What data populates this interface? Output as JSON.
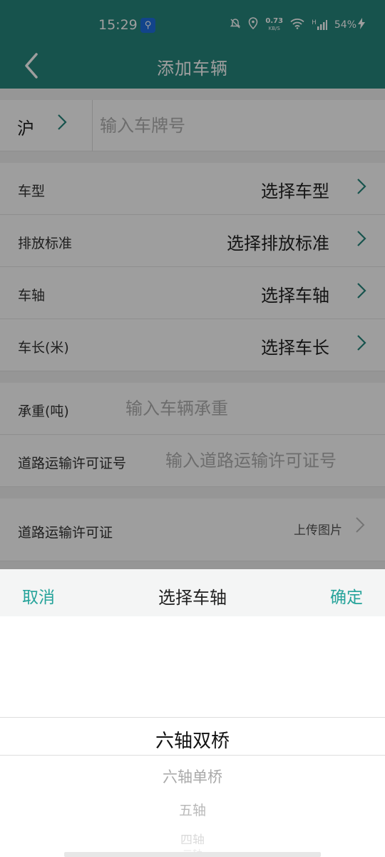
{
  "status_bar": {
    "time": "15:29",
    "speed_value": "0.73",
    "speed_unit": "KB/S",
    "network": "H",
    "battery": "54%"
  },
  "header": {
    "back_icon": "chevron-left-icon",
    "title": "添加车辆"
  },
  "plate": {
    "province": "沪",
    "placeholder": "输入车牌号"
  },
  "form": {
    "vehicle_type": {
      "label": "车型",
      "value": "选择车型"
    },
    "emission": {
      "label": "排放标准",
      "value": "选择排放标准"
    },
    "axle": {
      "label": "车轴",
      "value": "选择车轴"
    },
    "length": {
      "label": "车长(米)",
      "value": "选择车长"
    },
    "load": {
      "label": "承重(吨)",
      "placeholder": "输入车辆承重"
    },
    "permit_no": {
      "label": "道路运输许可证号",
      "placeholder": "输入道路运输许可证号"
    },
    "permit_img": {
      "label": "道路运输许可证",
      "value": "上传图片"
    }
  },
  "picker": {
    "cancel": "取消",
    "title": "选择车轴",
    "confirm": "确定",
    "selected": "六轴双桥",
    "options": [
      "六轴单桥",
      "五轴",
      "四轴",
      "三轴"
    ]
  },
  "colors": {
    "primary": "#26867d",
    "accent": "#25a39a"
  }
}
